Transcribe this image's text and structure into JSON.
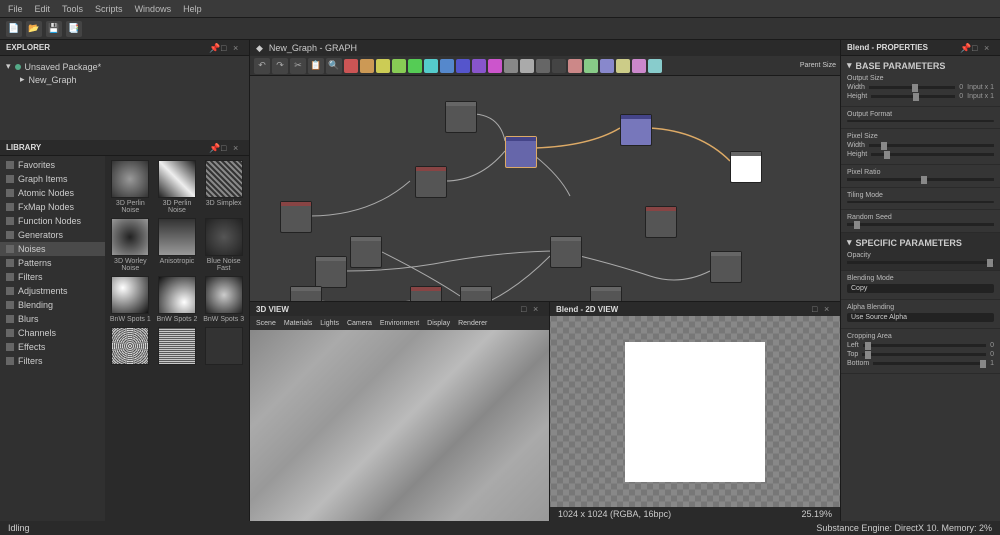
{
  "menu": {
    "items": [
      "File",
      "Edit",
      "Tools",
      "Scripts",
      "Windows",
      "Help"
    ]
  },
  "explorer": {
    "title": "EXPLORER",
    "root": "Unsaved Package*",
    "item": "New_Graph"
  },
  "library": {
    "title": "LIBRARY",
    "cats": [
      "Favorites",
      "Graph Items",
      "Atomic Nodes",
      "FxMap Nodes",
      "Function Nodes",
      "Generators",
      "Noises",
      "Patterns",
      "Filters",
      "Adjustments",
      "Blending",
      "Blurs",
      "Channels",
      "Effects",
      "Filters"
    ],
    "selected": 6,
    "items": [
      {
        "label": "3D Perlin Noise"
      },
      {
        "label": "3D Perlin Noise"
      },
      {
        "label": "3D Simplex"
      },
      {
        "label": "3D Worley Noise"
      },
      {
        "label": "Anisotropic"
      },
      {
        "label": "Blue Noise Fast"
      },
      {
        "label": "BnW Spots 1"
      },
      {
        "label": "BnW Spots 2"
      },
      {
        "label": "BnW Spots 3"
      },
      {
        "label": ""
      },
      {
        "label": ""
      },
      {
        "label": ""
      }
    ]
  },
  "graph": {
    "tab": "New_Graph - GRAPH",
    "parent_label": "Parent Size",
    "colors": [
      "#c55",
      "#c95",
      "#cc5",
      "#8c5",
      "#5c5",
      "#5cc",
      "#58c",
      "#55c",
      "#85c",
      "#c5c",
      "#888",
      "#aaa",
      "#666",
      "#444",
      "#c88",
      "#8c8",
      "#88c",
      "#cc8",
      "#c8c",
      "#8cc"
    ]
  },
  "view3d": {
    "title": "3D VIEW",
    "toolbar": [
      "Scene",
      "Materials",
      "Lights",
      "Camera",
      "Environment",
      "Display",
      "Renderer"
    ]
  },
  "view2d": {
    "title": "Blend - 2D VIEW",
    "info": "1024 x 1024 (RGBA, 16bpc)",
    "zoom": "25.19%"
  },
  "status": {
    "left": "Idling",
    "right": "Substance Engine: DirectX 10. Memory: 2%"
  },
  "props": {
    "title": "Blend - PROPERTIES",
    "base": "BASE PARAMETERS",
    "output_size": "Output Size",
    "width": "Width",
    "width_val": "0",
    "width_hint": "Input x 1",
    "height": "Height",
    "height_val": "0",
    "height_hint": "Input x 1",
    "output_format": "Output Format",
    "pixel_size": "Pixel Size",
    "pixel_ratio": "Pixel Ratio",
    "tiling_mode": "Tiling Mode",
    "random_seed": "Random Seed",
    "specific": "SPECIFIC PARAMETERS",
    "opacity": "Opacity",
    "blending_mode": "Blending Mode",
    "blend_val": "Copy",
    "alpha_blending": "Alpha Blending",
    "alpha_val": "Use Source Alpha",
    "cropping": "Cropping Area",
    "crop_left": "Left",
    "crop_top": "Top",
    "crop_bottom": "Bottom",
    "crop_v0": "0",
    "crop_v1": "1"
  }
}
